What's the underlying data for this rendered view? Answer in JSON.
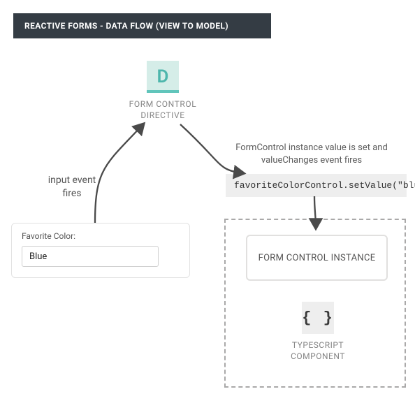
{
  "title": "REACTIVE FORMS - DATA FLOW (VIEW TO MODEL)",
  "directive": {
    "icon_letter": "D",
    "label_line1": "FORM CONTROL",
    "label_line2": "DIRECTIVE"
  },
  "note": "FormControl instance value is set and valueChanges event fires",
  "code": "favoriteColorControl.setValue(\"blue\")",
  "event_label_line1": "input event",
  "event_label_line2": "fires",
  "form": {
    "label": "Favorite Color:",
    "value": "Blue"
  },
  "instance_label": "FORM CONTROL INSTANCE",
  "ts": {
    "icon": "{ }",
    "label_line1": "TYPESCRIPT",
    "label_line2": "COMPONENT"
  }
}
